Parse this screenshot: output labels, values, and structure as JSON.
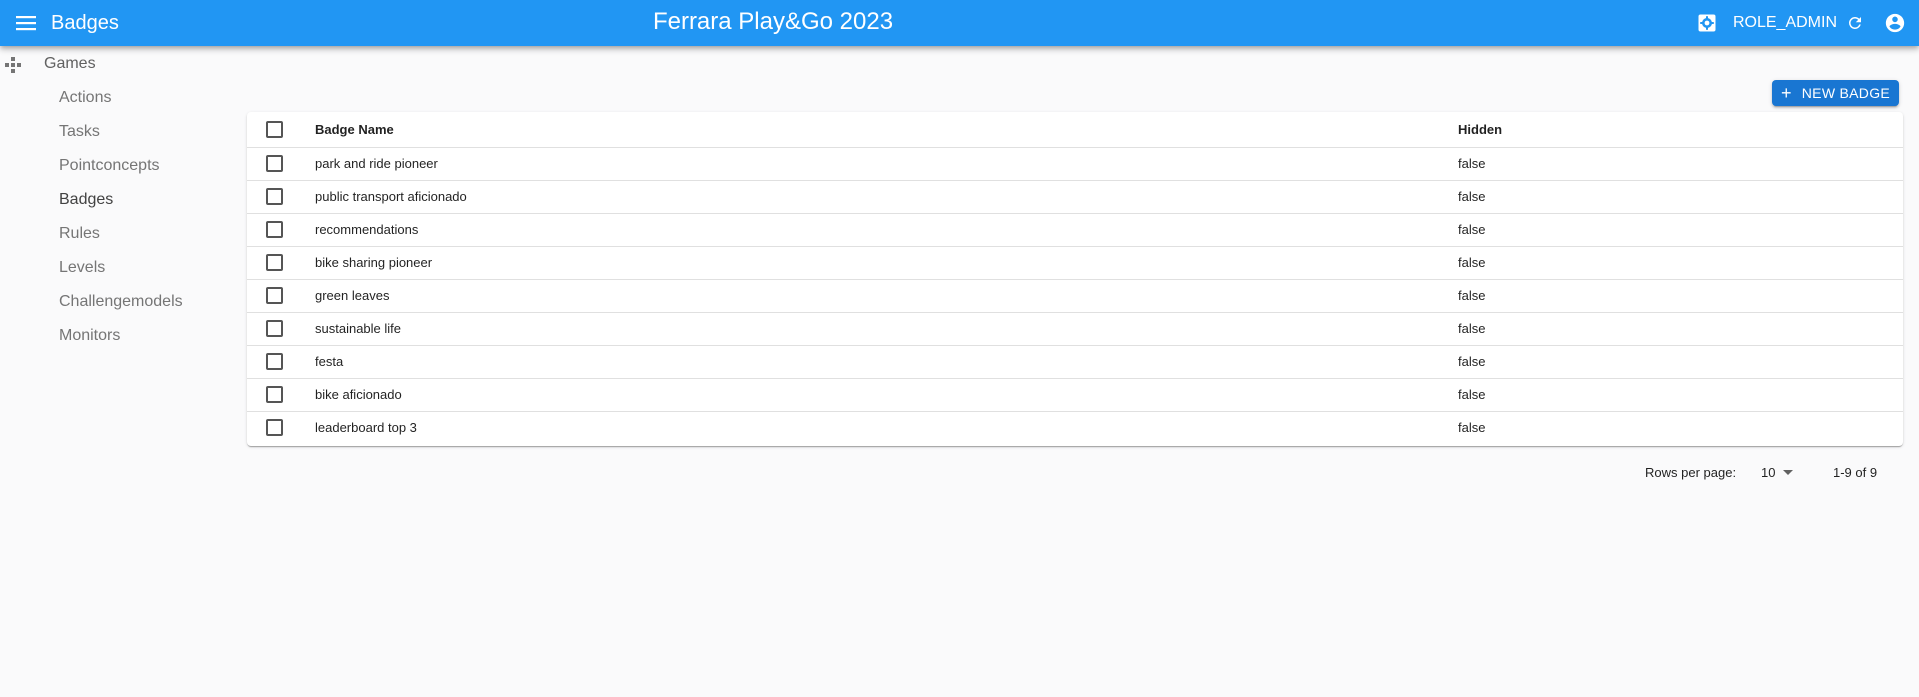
{
  "appbar": {
    "section_title": "Badges",
    "center_title": "Ferrara Play&Go 2023",
    "role": "ROLE_ADMIN",
    "icons": [
      "menu-icon",
      "settings-icon",
      "refresh-icon",
      "account-circle-icon"
    ],
    "color": "#2196f3"
  },
  "sidebar": {
    "games_label": "Games",
    "items": [
      {
        "label": "Actions"
      },
      {
        "label": "Tasks"
      },
      {
        "label": "Pointconcepts"
      },
      {
        "label": "Badges"
      },
      {
        "label": "Rules"
      },
      {
        "label": "Levels"
      },
      {
        "label": "Challengemodels"
      },
      {
        "label": "Monitors"
      }
    ]
  },
  "toolbar": {
    "new_button_label": "NEW BADGE",
    "new_button_color": "#1976d2"
  },
  "table": {
    "columns": [
      "Badge Name",
      "Hidden"
    ],
    "rows": [
      {
        "name": "park and ride pioneer",
        "hidden": "false"
      },
      {
        "name": "public transport aficionado",
        "hidden": "false"
      },
      {
        "name": "recommendations",
        "hidden": "false"
      },
      {
        "name": "bike sharing pioneer",
        "hidden": "false"
      },
      {
        "name": "green leaves",
        "hidden": "false"
      },
      {
        "name": "sustainable life",
        "hidden": "false"
      },
      {
        "name": "festa",
        "hidden": "false"
      },
      {
        "name": "bike aficionado",
        "hidden": "false"
      },
      {
        "name": "leaderboard top 3",
        "hidden": "false"
      }
    ]
  },
  "pagination": {
    "rows_per_page_label": "Rows per page:",
    "rows_per_page": "10",
    "range": "1-9 of 9"
  }
}
